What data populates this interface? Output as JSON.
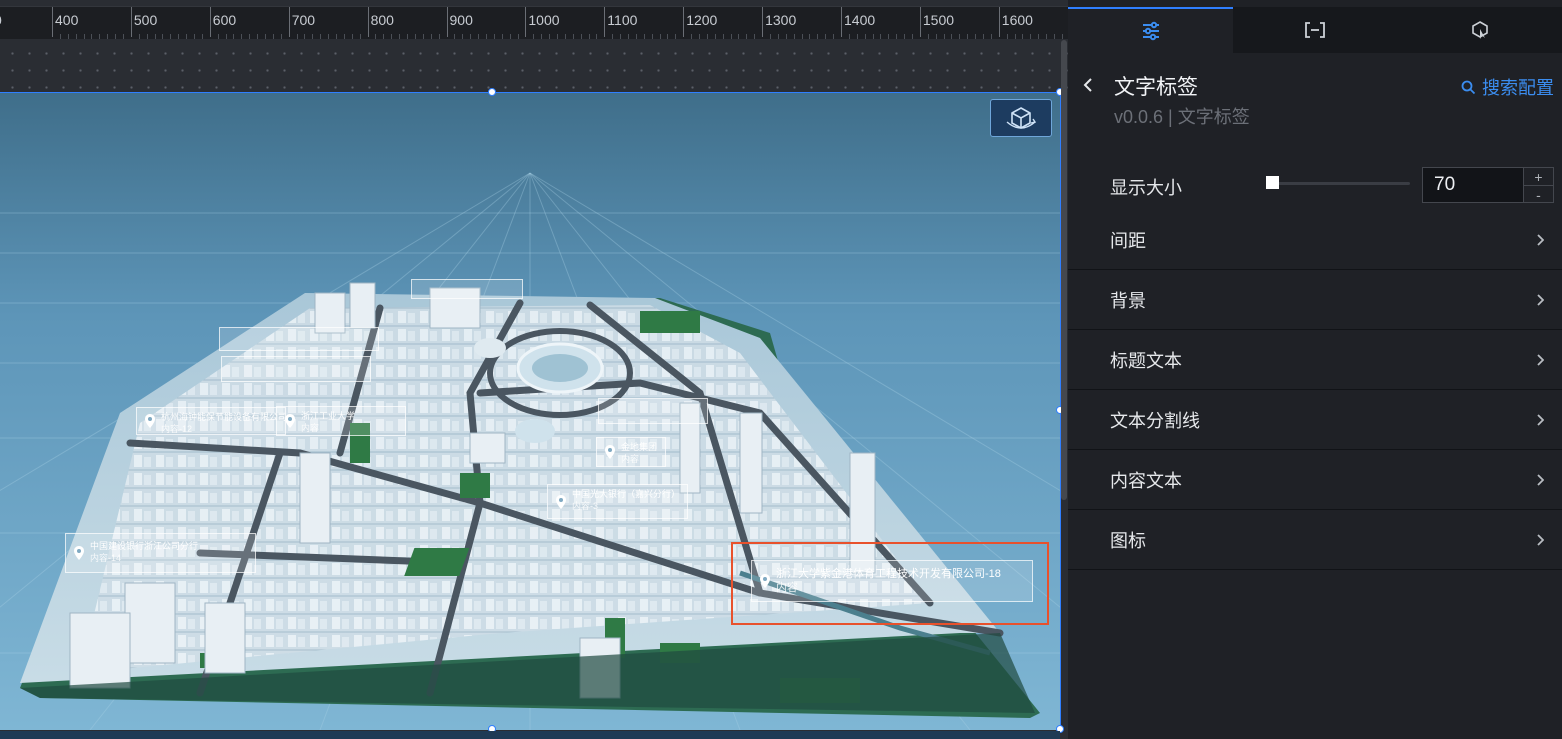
{
  "ruler": {
    "ticks": [
      "400",
      "500",
      "600",
      "700",
      "800",
      "900",
      "1000",
      "1100",
      "1200",
      "1300",
      "1400",
      "1500",
      "1600"
    ],
    "partial_left": "0"
  },
  "map_labels": [
    {
      "title": "杭州海钟能保节能设备有限公司",
      "sub": "内容-12"
    },
    {
      "title": "中国建设银行浙江公司分行",
      "sub": "内容-14"
    },
    {
      "title": "中国光大银行（嘉兴分行）",
      "sub": "内容-3"
    },
    {
      "title": "浙江大学紫金港体育工程技术开发有限公司-18",
      "sub": "内容"
    },
    {
      "title": "浙江工业大学",
      "sub": "内容"
    },
    {
      "title": "金地集团",
      "sub": "内容"
    }
  ],
  "panel": {
    "tabs": [
      {
        "icon": "sliders-icon",
        "active": true
      },
      {
        "icon": "bracket-box-icon",
        "active": false
      },
      {
        "icon": "interaction-cube-icon",
        "active": false
      }
    ],
    "title": "文字标签",
    "subtitle": "v0.0.6 | 文字标签",
    "search_label": "搜索配置",
    "size": {
      "label": "显示大小",
      "value": "70",
      "slider_fraction": 0.04,
      "plus": "+",
      "minus": "-"
    },
    "sections": [
      "间距",
      "背景",
      "标题文本",
      "文本分割线",
      "内容文本",
      "图标"
    ]
  },
  "colors": {
    "accent": "#2f7fff",
    "selection": "#e8512c",
    "panel_bg": "#1f2126",
    "scene_sky": "#6aa4c7"
  }
}
